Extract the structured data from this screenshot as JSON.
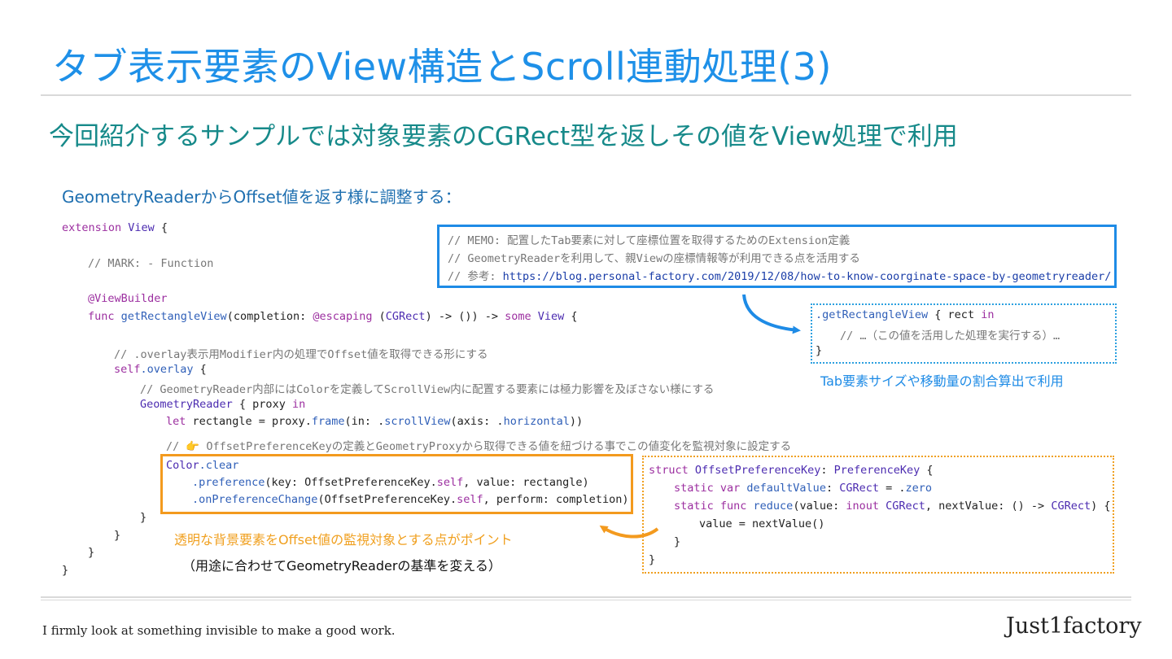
{
  "title": "タブ表示要素のView構造とScroll連動処理(3)",
  "subtitle": "今回紹介するサンプルでは対象要素のCGRect型を返しその値をView処理で利用",
  "lead": "GeometryReaderからOffset値を返す様に調整する：",
  "code": {
    "l1_kw": "extension",
    "l1_ty": " View",
    "l1_rest": " {",
    "l2": "// MARK: - Function",
    "l3": "@ViewBuilder",
    "l4_kw": "func",
    "l4_fn": " getRectangleView",
    "l4_a": "(completion: ",
    "l4_kw2": "@escaping",
    "l4_b": " (",
    "l4_ty": "CGRect",
    "l4_c": ") -> ()) -> ",
    "l4_kw3": "some",
    "l4_ty2": " View",
    "l4_d": " {",
    "l5": "// .overlay表示用Modifier内の処理でOffset値を取得できる形にする",
    "l6_kw": "self",
    "l6_fn": ".overlay",
    "l6_rest": " {",
    "l7": "// GeometryReader内部にはColorを定義してScrollView内に配置する要素には極力影響を及ぼさない様にする",
    "l8_ty": "GeometryReader",
    "l8_a": " { proxy ",
    "l8_kw": "in",
    "l9_kw": "let",
    "l9_a": " rectangle = proxy.",
    "l9_fn": "frame",
    "l9_b": "(in: .",
    "l9_fn2": "scrollView",
    "l9_c": "(axis: .",
    "l9_fn3": "horizontal",
    "l9_d": "))",
    "l10a": "// ",
    "l10_emoji": "👉",
    "l10b": " OffsetPreferenceKeyの定義とGeometryProxyから取得できる値を紐づける事でこの値変化を監視対象に設定する",
    "l11_ty": "Color",
    "l11_fn": ".clear",
    "l12_fn": ".preference",
    "l12_a": "(key: OffsetPreferenceKey.",
    "l12_kw": "self",
    "l12_b": ", value: rectangle)",
    "l13_fn": ".onPreferenceChange",
    "l13_a": "(OffsetPreferenceKey.",
    "l13_kw": "self",
    "l13_b": ", perform: completion)",
    "brace": "}"
  },
  "memo": {
    "l1": "// MEMO: 配置したTab要素に対して座標位置を取得するためのExtension定義",
    "l2": "// GeometryReaderを利用して、親Viewの座標情報等が利用できる点を活用する",
    "l3_prefix": "// 参考: ",
    "l3_url": "https://blog.personal-factory.com/2019/12/08/how-to-know-coorginate-space-by-geometryreader/"
  },
  "usage": {
    "l1_fn": ".getRectangleView",
    "l1_a": " { rect ",
    "l1_kw": "in",
    "l2": "// …（この値を活用した処理を実行する）…",
    "l3": "}"
  },
  "struct_code": {
    "l1_kw": "struct",
    "l1_ty": " OffsetPreferenceKey",
    "l1_a": ": ",
    "l1_ty2": "PreferenceKey",
    "l1_b": " {",
    "l2_kw": "static var",
    "l2_fn": " defaultValue",
    "l2_a": ": ",
    "l2_ty": "CGRect",
    "l2_b": " = .",
    "l2_fn2": "zero",
    "l3_kw": "static func",
    "l3_fn": " reduce",
    "l3_a": "(value: ",
    "l3_kw2": "inout",
    "l3_ty": " CGRect",
    "l3_b": ", nextValue: () -> ",
    "l3_ty2": "CGRect",
    "l3_c": ") {",
    "l4": "value = nextValue()",
    "l5": "}",
    "l6": "}"
  },
  "notes": {
    "blue": "Tab要素サイズや移動量の割合算出で利用",
    "orange": "透明な背景要素をOffset値の監視対象とする点がポイント",
    "black": "（用途に合わせてGeometryReaderの基準を変える）"
  },
  "footer": {
    "tagline": "I firmly look at something invisible to make a good work.",
    "brand": "Just1factory"
  },
  "colors": {
    "title": "#1e90e8",
    "subtitle": "#178a8a",
    "accent_blue": "#1e8be6",
    "accent_orange": "#f39a1e"
  }
}
